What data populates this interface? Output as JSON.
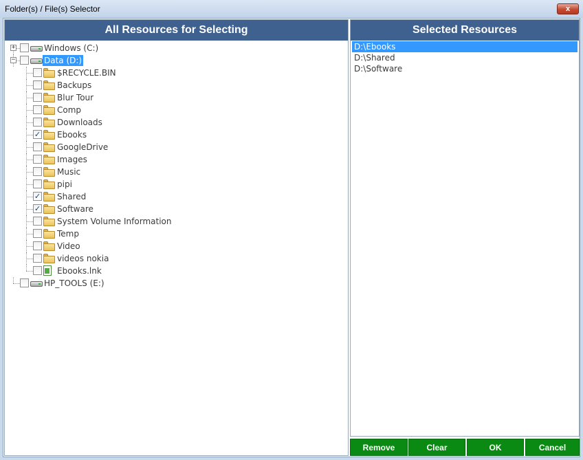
{
  "window": {
    "title": "Folder(s) / File(s) Selector",
    "close_label": "x"
  },
  "left_panel": {
    "title": "All Resources for Selecting",
    "tree": [
      {
        "label": "Windows (C:)",
        "icon": "drive-icon",
        "level": 0,
        "expander": "+",
        "checked": false,
        "selected": false
      },
      {
        "label": "Data (D:)",
        "icon": "drive-icon",
        "level": 0,
        "expander": "−",
        "checked": false,
        "selected": true
      },
      {
        "label": "$RECYCLE.BIN",
        "icon": "folder-icon",
        "level": 1,
        "checked": false
      },
      {
        "label": "Backups",
        "icon": "folder-icon",
        "level": 1,
        "checked": false
      },
      {
        "label": "Blur Tour",
        "icon": "folder-icon",
        "level": 1,
        "checked": false
      },
      {
        "label": "Comp",
        "icon": "folder-icon",
        "level": 1,
        "checked": false
      },
      {
        "label": "Downloads",
        "icon": "folder-icon",
        "level": 1,
        "checked": false
      },
      {
        "label": "Ebooks",
        "icon": "folder-icon",
        "level": 1,
        "checked": true
      },
      {
        "label": "GoogleDrive",
        "icon": "folder-icon",
        "level": 1,
        "checked": false
      },
      {
        "label": "Images",
        "icon": "folder-icon",
        "level": 1,
        "checked": false
      },
      {
        "label": "Music",
        "icon": "folder-icon",
        "level": 1,
        "checked": false
      },
      {
        "label": "pipi",
        "icon": "folder-icon",
        "level": 1,
        "checked": false
      },
      {
        "label": "Shared",
        "icon": "folder-icon",
        "level": 1,
        "checked": true
      },
      {
        "label": "Software",
        "icon": "folder-icon",
        "level": 1,
        "checked": true
      },
      {
        "label": "System Volume Information",
        "icon": "folder-icon",
        "level": 1,
        "checked": false
      },
      {
        "label": "Temp",
        "icon": "folder-icon",
        "level": 1,
        "checked": false
      },
      {
        "label": "Video",
        "icon": "folder-icon",
        "level": 1,
        "checked": false
      },
      {
        "label": "videos nokia",
        "icon": "folder-icon",
        "level": 1,
        "checked": false
      },
      {
        "label": "Ebooks.lnk",
        "icon": "file-icon",
        "level": 1,
        "checked": false
      },
      {
        "label": "HP_TOOLS (E:)",
        "icon": "drive-icon",
        "level": 0,
        "expander": "",
        "checked": false,
        "selected": false
      }
    ]
  },
  "right_panel": {
    "title": "Selected Resources",
    "items": [
      {
        "label": "D:\\Ebooks",
        "active": true
      },
      {
        "label": "D:\\Shared",
        "active": false
      },
      {
        "label": "D:\\Software",
        "active": false
      }
    ]
  },
  "buttons": {
    "remove": "Remove",
    "clear": "Clear",
    "ok": "OK",
    "cancel": "Cancel"
  },
  "colors": {
    "header_bg": "#3e618f",
    "selection": "#3399ff",
    "button_bg": "#0a8a12",
    "window_bg": "#c9d9ec"
  }
}
